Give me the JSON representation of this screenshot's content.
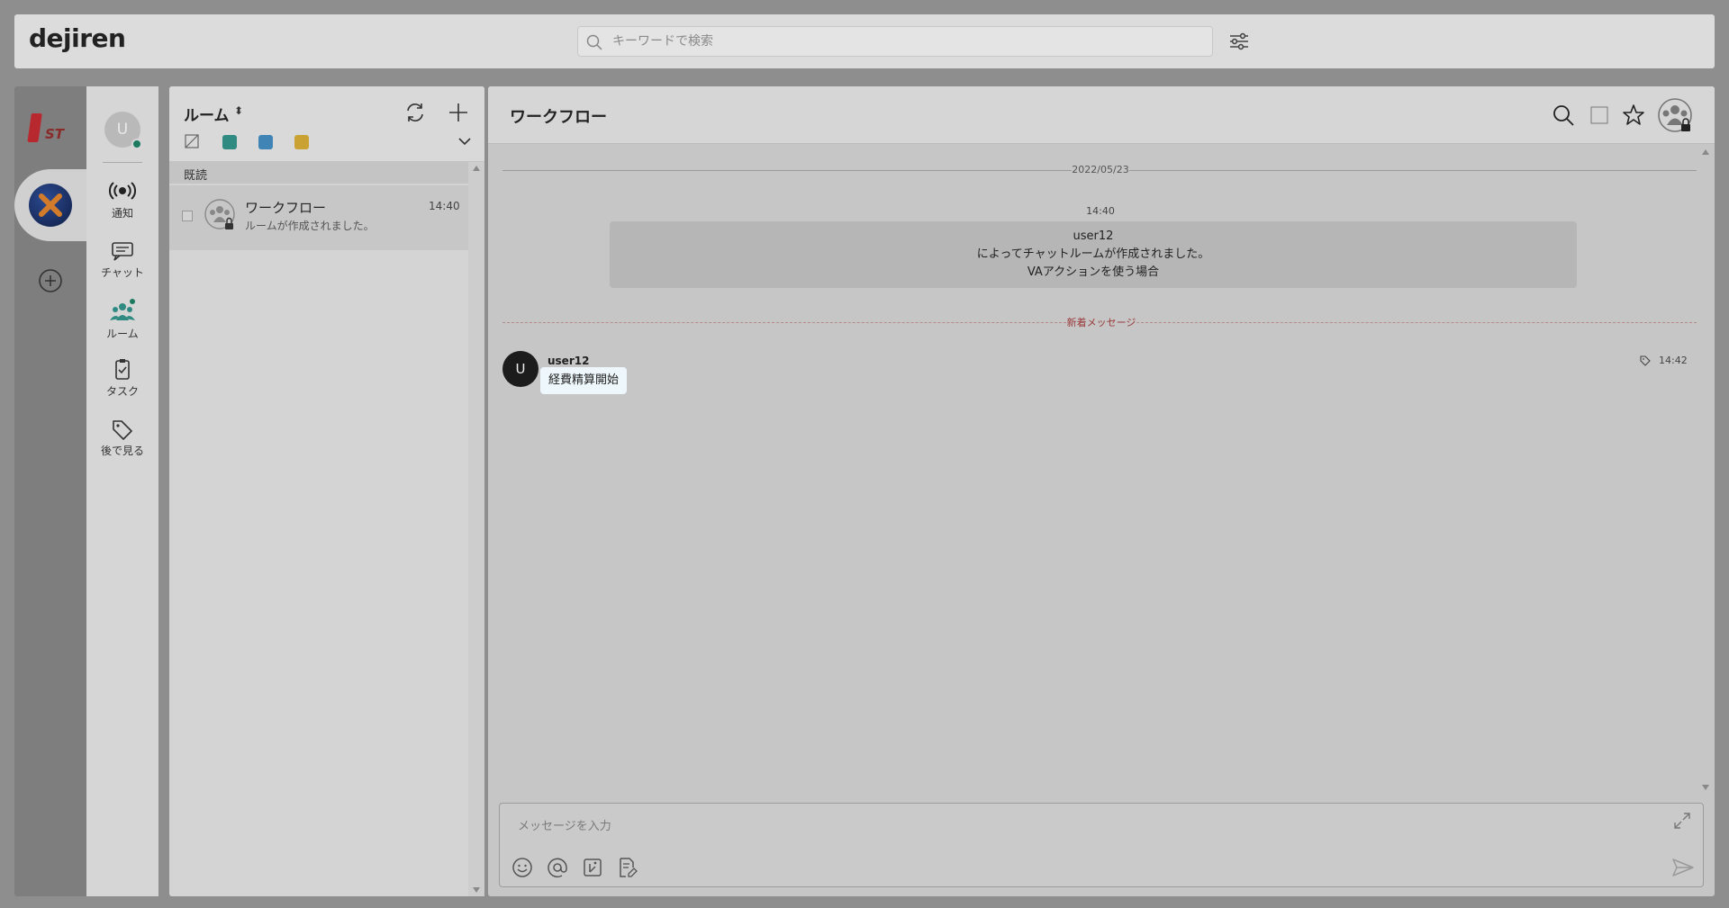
{
  "header": {
    "logo": "dejiren",
    "search_placeholder": "キーワードで検索"
  },
  "workspaces": {
    "first_logo": "1ST"
  },
  "user": {
    "avatar_initial": "U"
  },
  "nav": {
    "items": [
      {
        "label": "通知",
        "icon": "broadcast-icon"
      },
      {
        "label": "チャット",
        "icon": "chat-icon"
      },
      {
        "label": "ルーム",
        "icon": "room-icon"
      },
      {
        "label": "タスク",
        "icon": "task-icon"
      },
      {
        "label": "後で見る",
        "icon": "tag-icon"
      }
    ]
  },
  "rooms": {
    "title": "ルーム",
    "sort_indicator": "⬍",
    "section_label": "既読",
    "items": [
      {
        "name": "ワークフロー",
        "preview": "ルームが作成されました。",
        "time": "14:40"
      }
    ],
    "tag_colors": [
      "#2f8a82",
      "#3f84b4",
      "#c9a233"
    ]
  },
  "chat": {
    "title": "ワークフロー",
    "date_divider": "2022/05/23",
    "system_time": "14:40",
    "system_message_lines": [
      "user12",
      "によってチャットルームが作成されました。",
      "VAアクションを使う場合"
    ],
    "new_messages_label": "新着メッセージ",
    "messages": [
      {
        "avatar_initial": "U",
        "user": "user12",
        "text": "経費精算開始",
        "time": "14:42"
      }
    ],
    "input_placeholder": "メッセージを入力"
  },
  "colors": {
    "online": "#1d7a5f",
    "room_accent": "#2f8a82",
    "new_message_divider": "#9a3b3b"
  }
}
